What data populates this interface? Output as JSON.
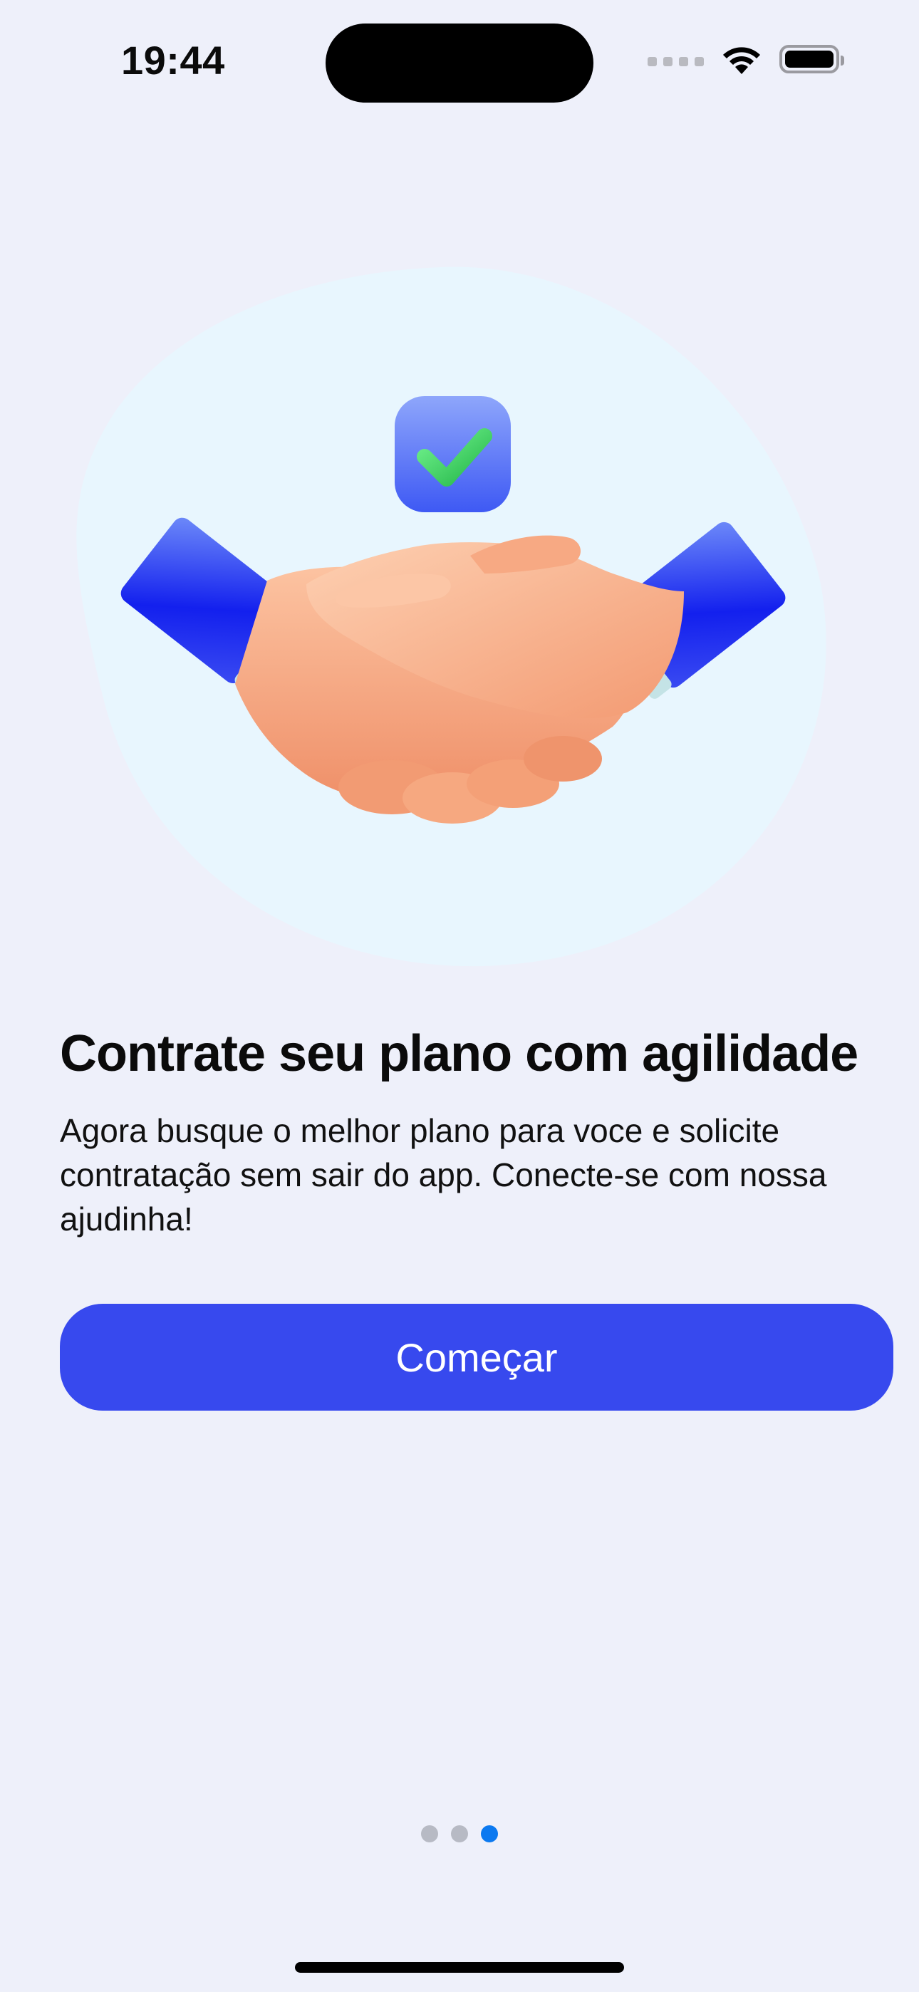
{
  "status_bar": {
    "time": "19:44"
  },
  "onboarding": {
    "title": "Contrate seu plano com agilidade",
    "description": "Agora busque o melhor plano para voce e solicite contratação sem sair do app. Conecte-se com nossa ajudinha!",
    "cta_label": "Começar",
    "pagination": {
      "total_pages": 3,
      "current_page": 3
    }
  },
  "illustration": {
    "icon": "handshake-with-checkmark",
    "colors": {
      "blob": "#e8f6fe",
      "sleeve": "#1d2bef",
      "cuff": "#bfe0e3",
      "skin": "#f7a680",
      "check_badge": "#4f70f7",
      "check_mark": "#43d15f"
    }
  },
  "theme": {
    "background": "#eef0fa",
    "primary": "#3749ee",
    "active_dot": "#0b79f0",
    "inactive_dot": "#b7bac4"
  }
}
